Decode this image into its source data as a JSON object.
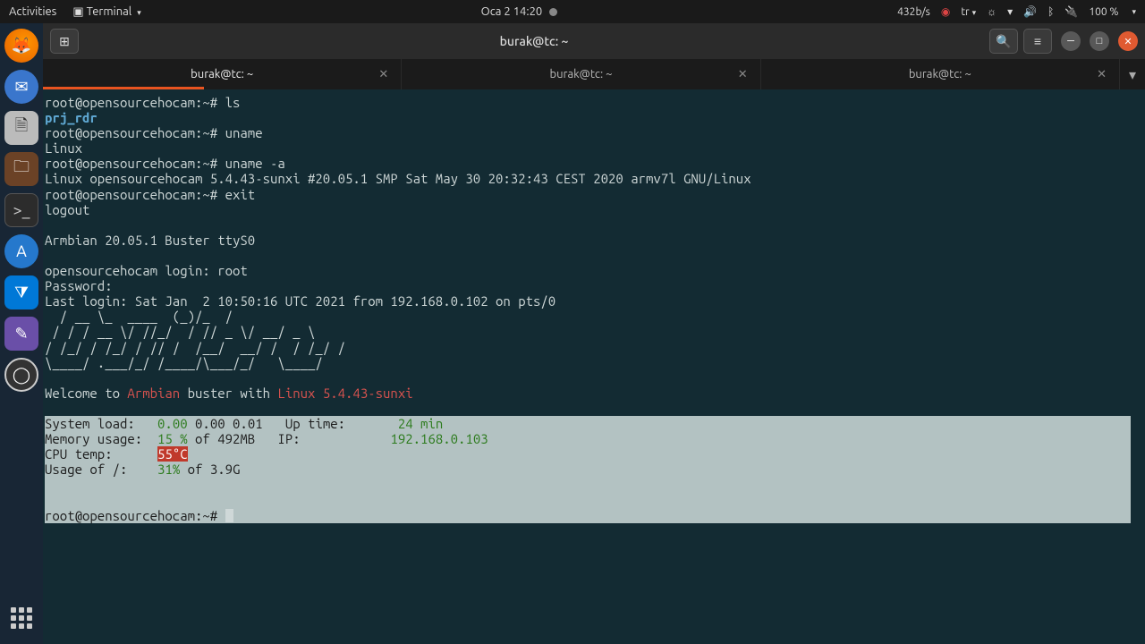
{
  "topbar": {
    "activities": "Activities",
    "app_menu": "Terminal",
    "clock": "Oca 2 14:20",
    "net_speed": "432b/s",
    "lang": "tr",
    "battery": "100 %"
  },
  "window": {
    "title": "burak@tc: ~"
  },
  "tabs": [
    {
      "label": "burak@tc: ~",
      "active": true
    },
    {
      "label": "burak@tc: ~",
      "active": false
    },
    {
      "label": "burak@tc: ~",
      "active": false
    }
  ],
  "term": {
    "prompt1": "root@opensourcehocam:~# ",
    "cmd_ls": "ls",
    "ls_output": "prj_rdr",
    "cmd_uname": "uname",
    "uname_output": "Linux",
    "cmd_uname_a": "uname -a",
    "uname_a_output": "Linux opensourcehocam 5.4.43-sunxi #20.05.1 SMP Sat May 30 20:32:43 CEST 2020 armv7l GNU/Linux",
    "cmd_exit": "exit",
    "logout": "logout",
    "armbian_line": "Armbian 20.05.1 Buster ttyS0",
    "login_line": "opensourcehocam login: root",
    "password_line": "Password:",
    "last_login": "Last login: Sat Jan  2 10:50:16 UTC 2021 from 192.168.0.102 on pts/0",
    "ascii_l1": "  / __ \\_  ____  (_)/_  /",
    "ascii_l2": " / / / __ \\/ //_/  / // _ \\/ __/ _ \\",
    "ascii_l3": "/ /_/ / /_/ / // /  /__/  __/ /  / /_/ /",
    "ascii_l4": "\\____/ .___/_/ /____/\\___/_/   \\____/",
    "welcome_prefix": "Welcome to ",
    "welcome_armbian": "Armbian",
    "welcome_mid": " buster with ",
    "welcome_kernel": "Linux 5.4.43-sunxi",
    "stats": {
      "sys_load_label": "System load:   ",
      "sys_load_green": "0.00",
      "sys_load_rest": " 0.00 0.01",
      "uptime_label": "   Up time:       ",
      "uptime_val": "24 min",
      "mem_label": "Memory usage:  ",
      "mem_green": "15 %",
      "mem_rest": " of 492MB",
      "ip_label": "   IP:            ",
      "ip_val": "192.168.0.103",
      "cpu_label": "CPU temp:      ",
      "cpu_val": "55°C",
      "usage_label": "Usage of /:    ",
      "usage_green": "31%",
      "usage_rest": " of 3.9G"
    },
    "prompt_final": "root@opensourcehocam:~# "
  }
}
